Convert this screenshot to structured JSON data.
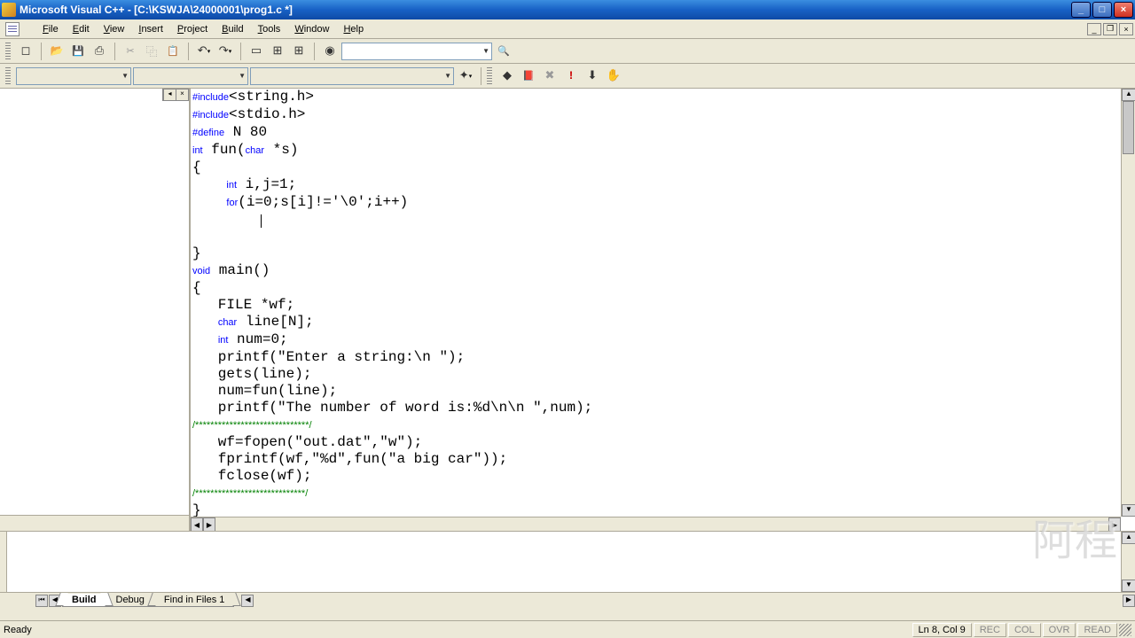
{
  "window": {
    "title": "Microsoft Visual C++ - [C:\\KSWJA\\24000001\\prog1.c *]"
  },
  "menu": {
    "items": [
      "File",
      "Edit",
      "View",
      "Insert",
      "Project",
      "Build",
      "Tools",
      "Window",
      "Help"
    ]
  },
  "code": {
    "lines": [
      {
        "t": "pp",
        "text": "#include<string.h>"
      },
      {
        "t": "pp",
        "text": "#include<stdio.h>"
      },
      {
        "t": "pp",
        "text": "#define N 80"
      },
      {
        "t": "mix",
        "parts": [
          [
            "kw",
            "int"
          ],
          [
            "",
            " fun("
          ],
          [
            "kw",
            "char"
          ],
          [
            "",
            " *s)"
          ]
        ]
      },
      {
        "t": "",
        "text": "{"
      },
      {
        "t": "mix",
        "parts": [
          [
            "",
            "    "
          ],
          [
            "kw",
            "int"
          ],
          [
            "",
            " i,j=1;"
          ]
        ]
      },
      {
        "t": "mix",
        "parts": [
          [
            "",
            "    "
          ],
          [
            "kw",
            "for"
          ],
          [
            "",
            "(i=0;s[i]!='\\0';i++)"
          ]
        ]
      },
      {
        "t": "cursor",
        "text": "        "
      },
      {
        "t": "",
        "text": ""
      },
      {
        "t": "",
        "text": "}"
      },
      {
        "t": "mix",
        "parts": [
          [
            "kw",
            "void"
          ],
          [
            "",
            " main()"
          ]
        ]
      },
      {
        "t": "",
        "text": "{"
      },
      {
        "t": "",
        "text": "   FILE *wf;"
      },
      {
        "t": "mix",
        "parts": [
          [
            "",
            "   "
          ],
          [
            "kw",
            "char"
          ],
          [
            "",
            " line[N];"
          ]
        ]
      },
      {
        "t": "mix",
        "parts": [
          [
            "",
            "   "
          ],
          [
            "kw",
            "int"
          ],
          [
            "",
            " num=0;"
          ]
        ]
      },
      {
        "t": "",
        "text": "   printf(\"Enter a string:\\n \");"
      },
      {
        "t": "",
        "text": "   gets(line);"
      },
      {
        "t": "",
        "text": "   num=fun(line);"
      },
      {
        "t": "",
        "text": "   printf(\"The number of word is:%d\\n\\n \",num);"
      },
      {
        "t": "cm",
        "text": "/******************************/"
      },
      {
        "t": "",
        "text": "   wf=fopen(\"out.dat\",\"w\");"
      },
      {
        "t": "",
        "text": "   fprintf(wf,\"%d\",fun(\"a big car\"));"
      },
      {
        "t": "",
        "text": "   fclose(wf);"
      },
      {
        "t": "cm",
        "text": "/*****************************/"
      },
      {
        "t": "",
        "text": "}"
      }
    ]
  },
  "output_tabs": {
    "build": "Build",
    "debug": "Debug",
    "find": "Find in Files 1"
  },
  "status": {
    "ready": "Ready",
    "pos": "Ln 8, Col 9",
    "rec": "REC",
    "col": "COL",
    "ovr": "OVR",
    "read": "READ"
  },
  "watermark": "阿程"
}
